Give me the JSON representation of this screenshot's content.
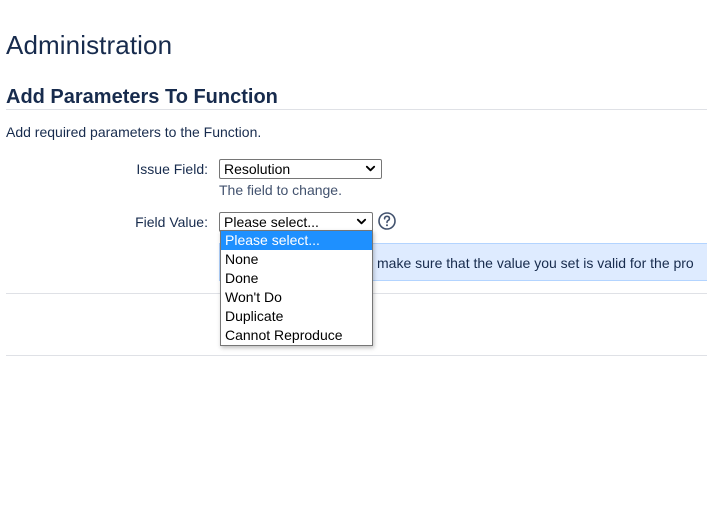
{
  "page": {
    "title": "Administration",
    "section_title": "Add Parameters To Function",
    "description": "Add required parameters to the Function."
  },
  "form": {
    "issue_field": {
      "label": "Issue Field:",
      "selected": "Resolution",
      "help": "The field to change."
    },
    "field_value": {
      "label": "Field Value:",
      "selected": "Please select...",
      "help_icon": "question-circle-icon",
      "options": [
        "Please select...",
        "None",
        "Done",
        "Won't Do",
        "Duplicate",
        "Cannot Reproduce"
      ],
      "highlighted_index": 0
    }
  },
  "info": {
    "text": "make sure that the value you set is valid for the pro"
  },
  "colors": {
    "highlight": "#1e90ff",
    "info_background": "#deebff",
    "heading": "#172b4d"
  }
}
